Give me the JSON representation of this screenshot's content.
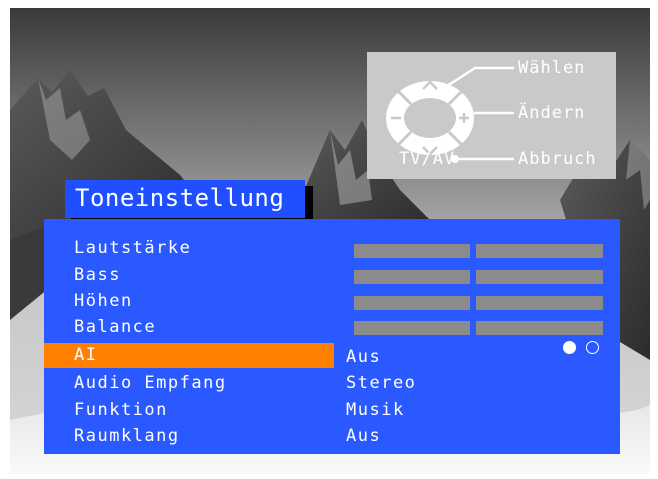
{
  "help": {
    "select_label": "Wählen",
    "change_label": "Ändern",
    "exit_label": "Abbruch",
    "tvav_label": "TV/AV"
  },
  "menu": {
    "title": "Toneinstellung",
    "items": [
      {
        "label": "Lautstärke",
        "value": "",
        "selected": false
      },
      {
        "label": "Bass",
        "value": "",
        "selected": false
      },
      {
        "label": "Höhen",
        "value": "",
        "selected": false
      },
      {
        "label": "Balance",
        "value": "",
        "selected": false
      },
      {
        "label": "AI",
        "value": "Aus",
        "selected": true,
        "options_total": 2,
        "option_selected_index": 0
      },
      {
        "label": "Audio Empfang",
        "value": "Stereo",
        "selected": false
      },
      {
        "label": "Funktion",
        "value": "Musik",
        "selected": false
      },
      {
        "label": "Raumklang",
        "value": "Aus",
        "selected": false
      }
    ]
  },
  "colors": {
    "menu_bg": "#2a59ff",
    "title_bg": "#1f4fff",
    "highlight": "#ff7f00",
    "bar": "#8b8b8b",
    "help_bg": "#c9c9c9"
  }
}
